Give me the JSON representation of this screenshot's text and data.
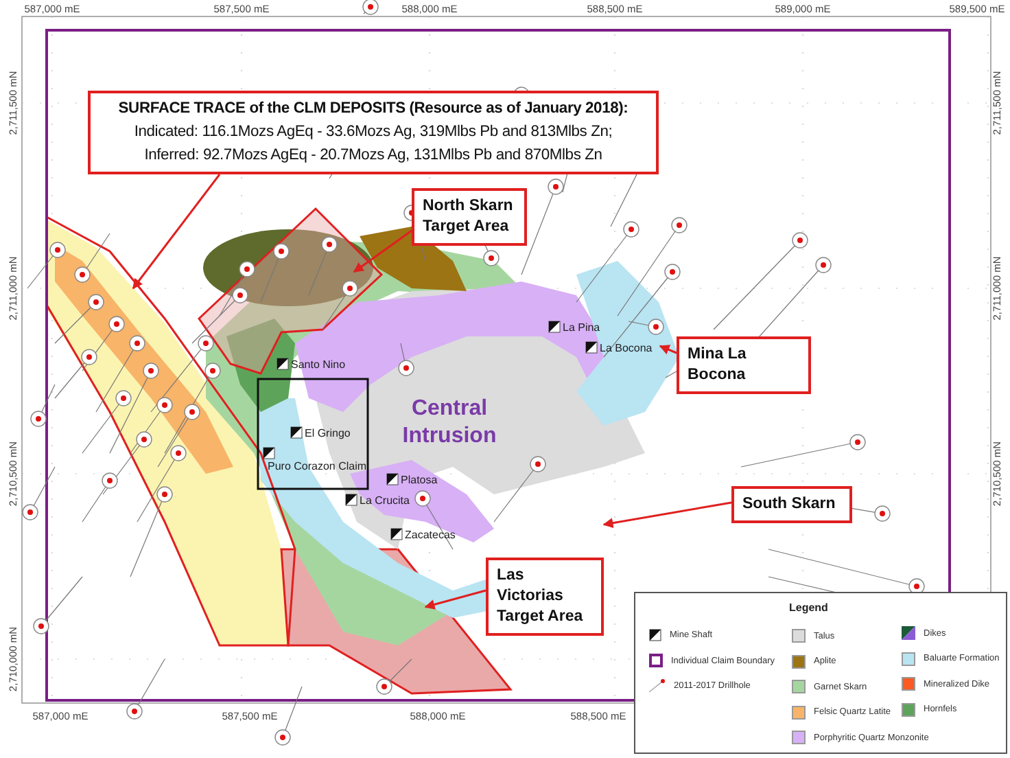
{
  "axes": {
    "top_ticks": [
      "587,000 mE",
      "587,500 mE",
      "588,000 mE",
      "588,500 mE",
      "589,000 mE",
      "589,500 mE"
    ],
    "bottom_ticks": [
      "587,000 mE",
      "587,500 mE",
      "588,000 mE",
      "588,500 mE"
    ],
    "left_ticks": [
      "2,711,500 mN",
      "2,711,000 mN",
      "2,710,500 mN",
      "2,710,000 mN"
    ],
    "right_ticks": [
      "2,711,500 mN",
      "2,711,000 mN",
      "2,710,500 mN"
    ]
  },
  "title_box": {
    "lines": [
      "SURFACE TRACE of the CLM DEPOSITS (Resource as of January 2018):",
      "Indicated: 116.1Mozs AgEq - 33.6Mozs Ag, 319Mlbs Pb and 813Mlbs Zn;",
      "Inferred: 92.7Mozs AgEq - 20.7Mozs Ag, 131Mlbs Pb and 870Mlbs Zn"
    ]
  },
  "callouts": [
    {
      "label": "North Skarn Target Area"
    },
    {
      "label": "Mina La Bocona"
    },
    {
      "label": "South Skarn"
    },
    {
      "label": "Las Victorias Target Area"
    }
  ],
  "area_label": "Central Intrusion",
  "mines": [
    {
      "name": "Santo Nino"
    },
    {
      "name": "El Gringo"
    },
    {
      "name": "Puro Corazon Claim"
    },
    {
      "name": "Platosa"
    },
    {
      "name": "La Crucita"
    },
    {
      "name": "Zacatecas"
    },
    {
      "name": "La Pina"
    },
    {
      "name": "La Bocona"
    }
  ],
  "legend": {
    "title": "Legend",
    "items": [
      {
        "kind": "shaft",
        "label": "Mine Shaft"
      },
      {
        "kind": "boundary",
        "label": "Individual Claim Boundary"
      },
      {
        "kind": "drillhole",
        "label": "2011-2017 Drillhole"
      },
      {
        "kind": "swatch",
        "label": "Talus",
        "color": "#dcdcdc"
      },
      {
        "kind": "swatch",
        "label": "Aplite",
        "color": "#9c7414"
      },
      {
        "kind": "swatch",
        "label": "Garnet Skarn",
        "color": "#a6d6a0"
      },
      {
        "kind": "swatch",
        "label": "Felsic Quartz Latite",
        "color": "#f8b468"
      },
      {
        "kind": "swatch",
        "label": "Porphyritic Quartz Monzonite",
        "color": "#d8b0f6"
      },
      {
        "kind": "split",
        "label": "Dikes",
        "parts": [
          {
            "color": "#1d5a3a"
          },
          {
            "color": "#8b5cd6"
          }
        ]
      },
      {
        "kind": "swatch",
        "label": "Baluarte Formation",
        "color": "#b9e4f2"
      },
      {
        "kind": "swatch",
        "label": "Mineralized Dike",
        "color": "#fb5a22"
      },
      {
        "kind": "swatch",
        "label": "Hornfels",
        "color": "#5da45a"
      }
    ]
  }
}
